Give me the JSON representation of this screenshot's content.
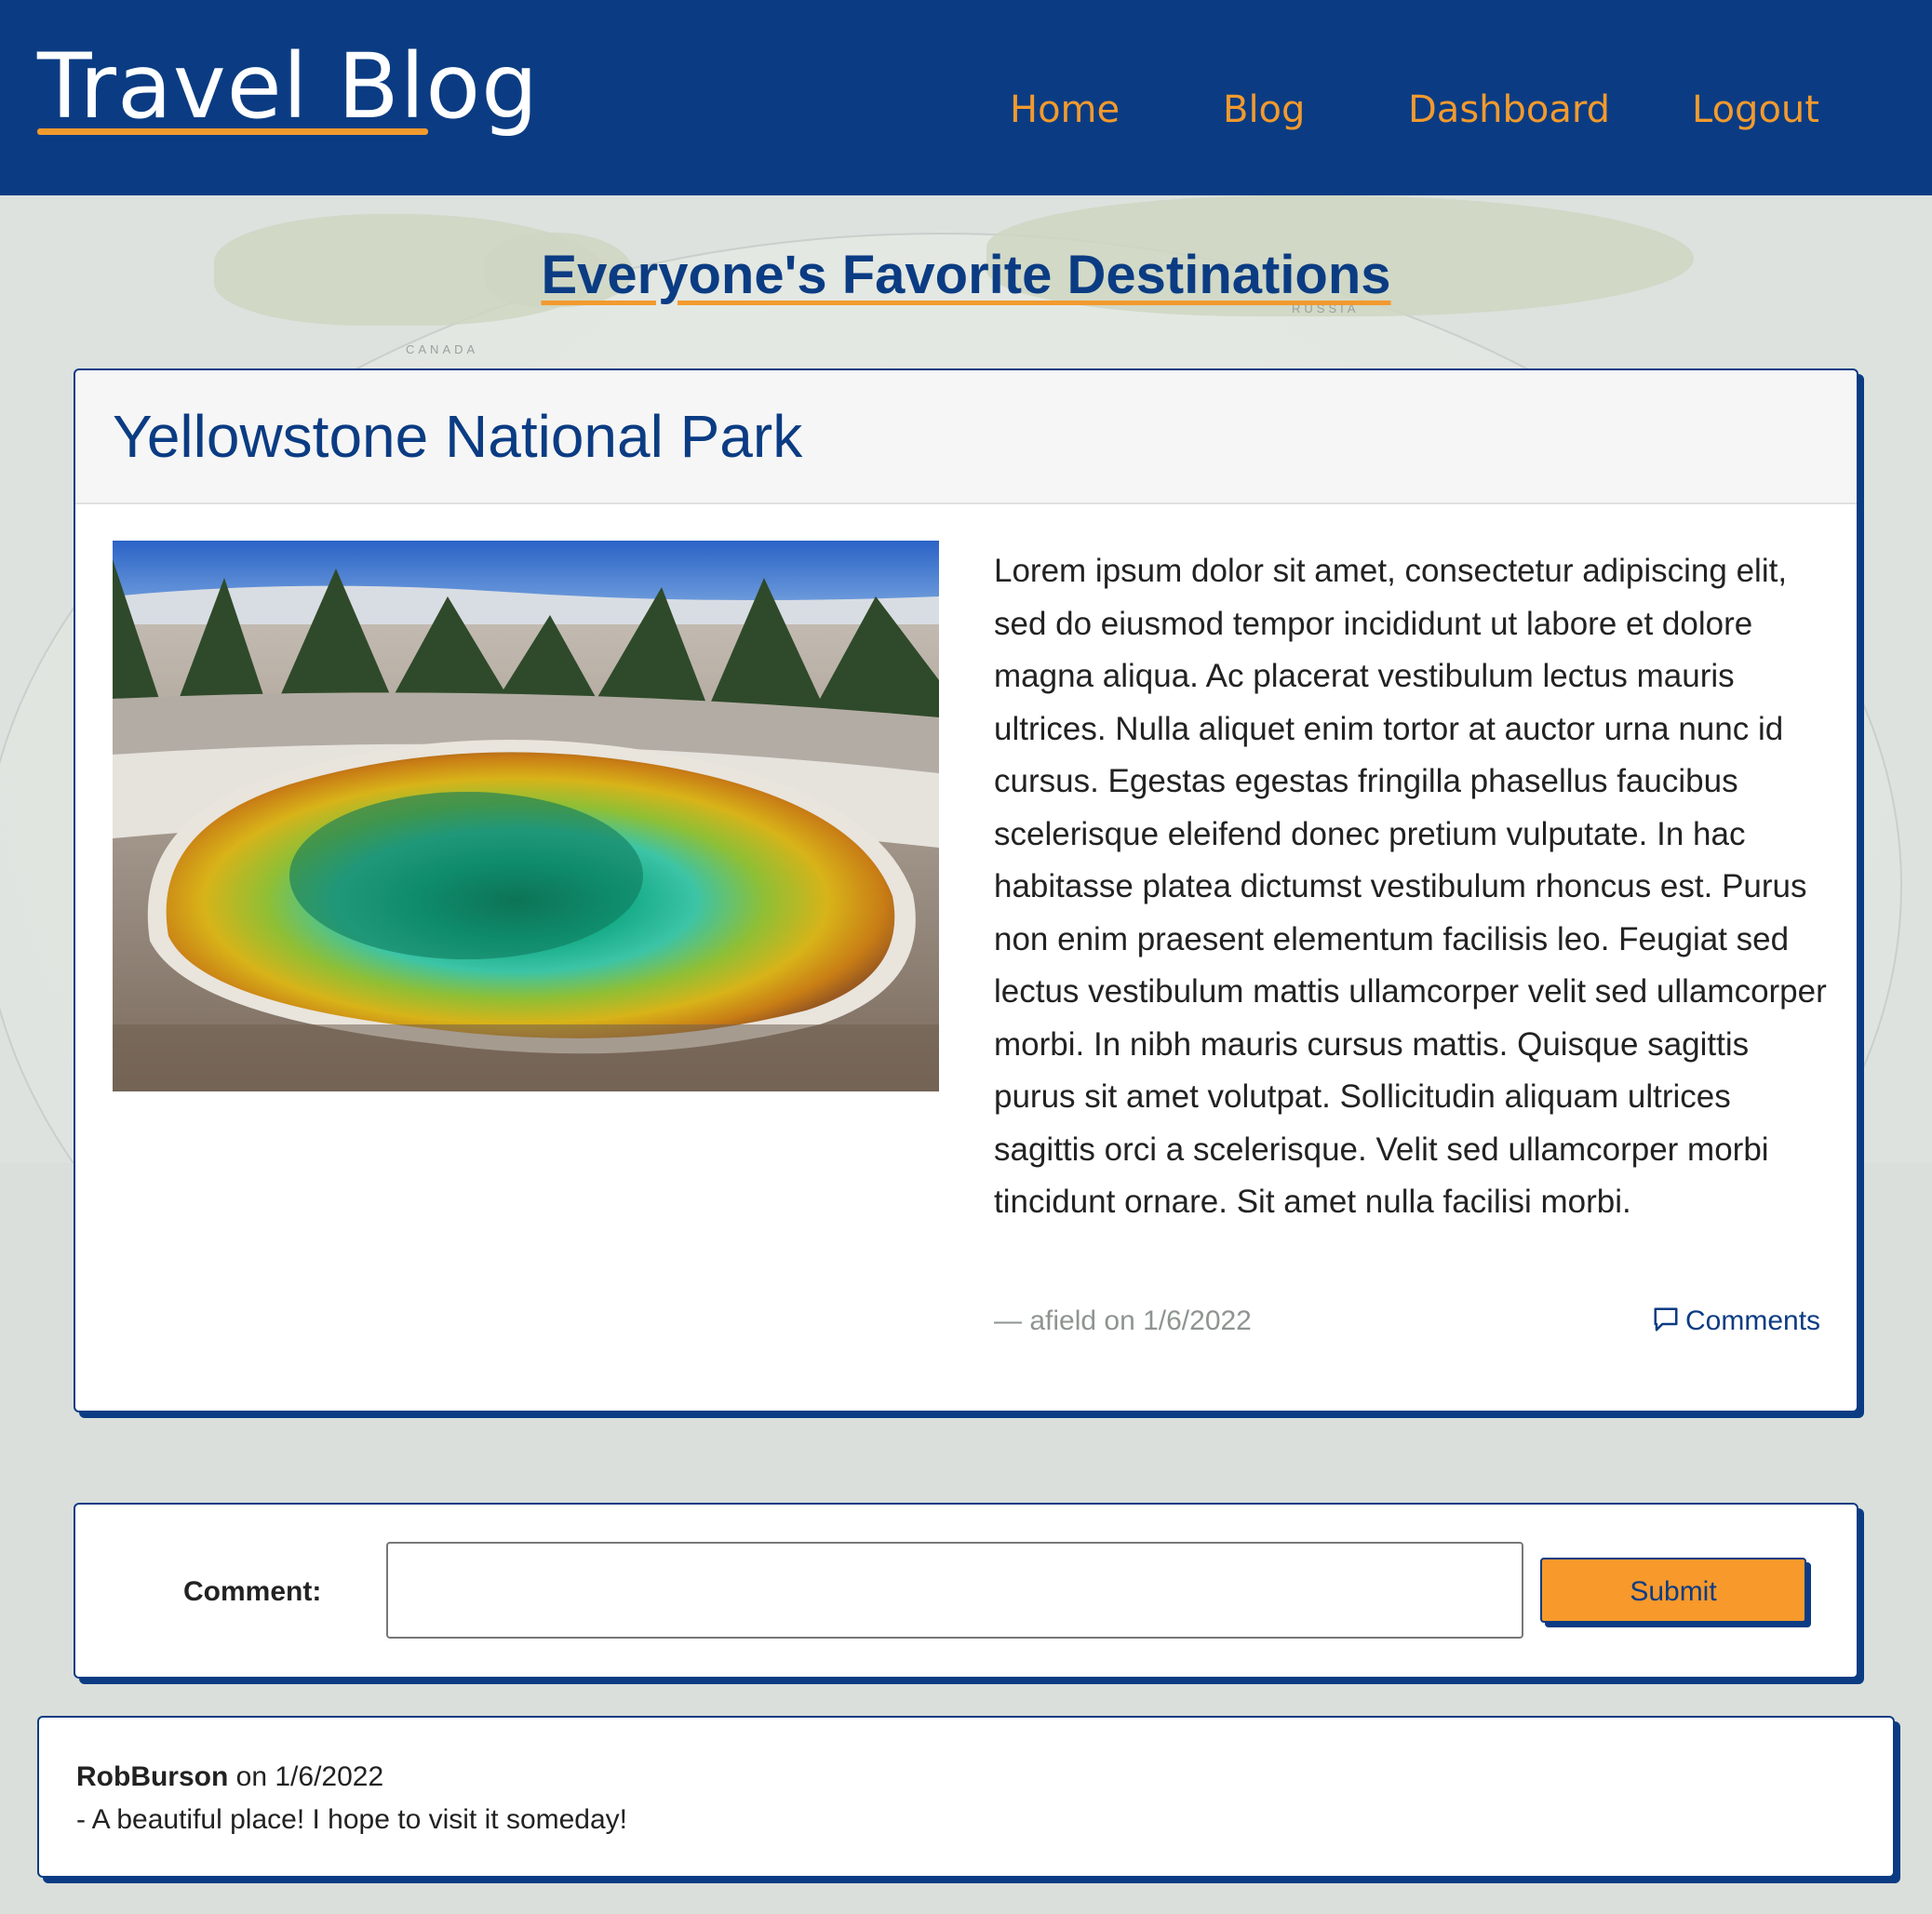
{
  "header": {
    "brand": "Travel Blog",
    "nav": [
      "Home",
      "Blog",
      "Dashboard",
      "Logout"
    ]
  },
  "page": {
    "title": "Everyone's Favorite Destinations"
  },
  "map_labels": [
    "CANADA",
    "RUSSIA"
  ],
  "post": {
    "title": "Yellowstone National Park",
    "body": "Lorem ipsum dolor sit amet, consectetur adipiscing elit, sed do eiusmod tempor incididunt ut labore et dolore magna aliqua. Ac placerat vestibulum lectus mauris ultrices. Nulla aliquet enim tortor at auctor urna nunc id cursus. Egestas egestas fringilla phasellus faucibus scelerisque eleifend donec pretium vulputate. In hac habitasse platea dictumst vestibulum rhoncus est. Purus non enim praesent elementum facilisis leo. Feugiat sed lectus vestibulum mattis ullamcorper velit sed ullamcorper morbi. In nibh mauris cursus mattis. Quisque sagittis purus sit amet volutpat. Sollicitudin aliquam ultrices sagittis orci a scelerisque. Velit sed ullamcorper morbi tincidunt ornare. Sit amet nulla facilisi morbi.",
    "meta": "— afield on 1/6/2022",
    "comments_label": "Comments",
    "image_icon": "hot-spring-photo"
  },
  "comment_form": {
    "label": "Comment:",
    "value": "",
    "submit_label": "Submit"
  },
  "comments": [
    {
      "author": "RobBurson",
      "date_text": "on 1/6/2022",
      "text": "- A beautiful place! I hope to visit it someday!"
    }
  ],
  "colors": {
    "brand_blue": "#0b3c83",
    "accent_orange": "#f29a2e",
    "background": "#dadfdb"
  }
}
